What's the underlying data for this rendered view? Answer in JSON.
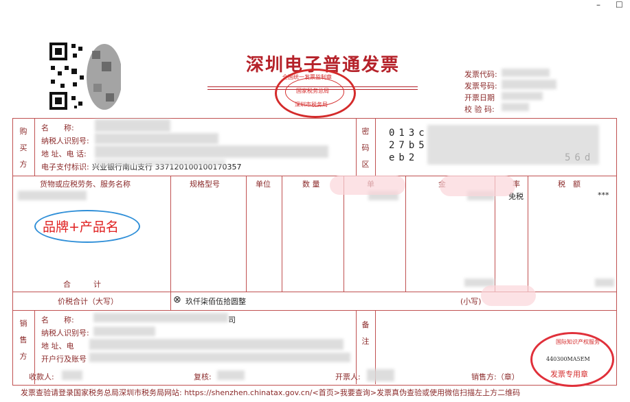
{
  "window": {
    "minimize_glyph": "–",
    "maximize_glyph": "☐"
  },
  "invoice": {
    "title": "深圳电子普通发票",
    "meta": {
      "code_label": "发票代码:",
      "number_label": "发票号码:",
      "date_label": "开票日期",
      "check_label": "校 验 码:"
    },
    "seal_top": {
      "line1": "全国统一发票监制章",
      "line2": "国家税务总局",
      "line3": "深圳市税务局"
    },
    "buyer": {
      "section": "购买方",
      "name_label": "名　　称:",
      "taxid_label": "纳税人识别号:",
      "address_label": "地 址、电 话:",
      "payment_label": "电子支付标识:",
      "payment_value": "兴业银行南山支行 337120100100170357"
    },
    "cipher": {
      "section": "密码区",
      "row1": "013c",
      "row2": "27b5",
      "row3": "eb2",
      "row3_tail": "56d"
    },
    "columns": {
      "goods": "货物或应税劳务、服务名称",
      "spec": "规格型号",
      "unit": "单位",
      "qty": "数 量",
      "price": "单",
      "amount": "金",
      "rate": "率",
      "tax": "税　额"
    },
    "rate_text": "免税",
    "tax_text": "***",
    "total_label": "合　　　计",
    "total_words_label": "价税合计（大写）",
    "total_words_value": "玖仟柒佰伍拾圆整",
    "total_small_label": "(小写)",
    "seller": {
      "section": "销售方",
      "name_label": "名　　称:",
      "name_tail": "司",
      "taxid_label": "纳税人识别号:",
      "address_label": "地 址、电",
      "bank_label": "开户行及账号",
      "remark_section": "备注"
    },
    "signatures": {
      "payee": "收款人:",
      "reviewer": "复核:",
      "drawer": "开票人:",
      "seller": "销售方:（章）"
    },
    "footer": "发票查验请登录国家税务总局深圳市税务局网站: https://shenzhen.chinatax.gov.cn/<首页>我要查询>发票真伪查验或使用微信扫描左上方二维码",
    "annotation": "品牌+产品名",
    "seal_bottom": {
      "line1": "国际知识产权服务",
      "number": "440300MA5EM",
      "line2": "发票专用章"
    }
  }
}
